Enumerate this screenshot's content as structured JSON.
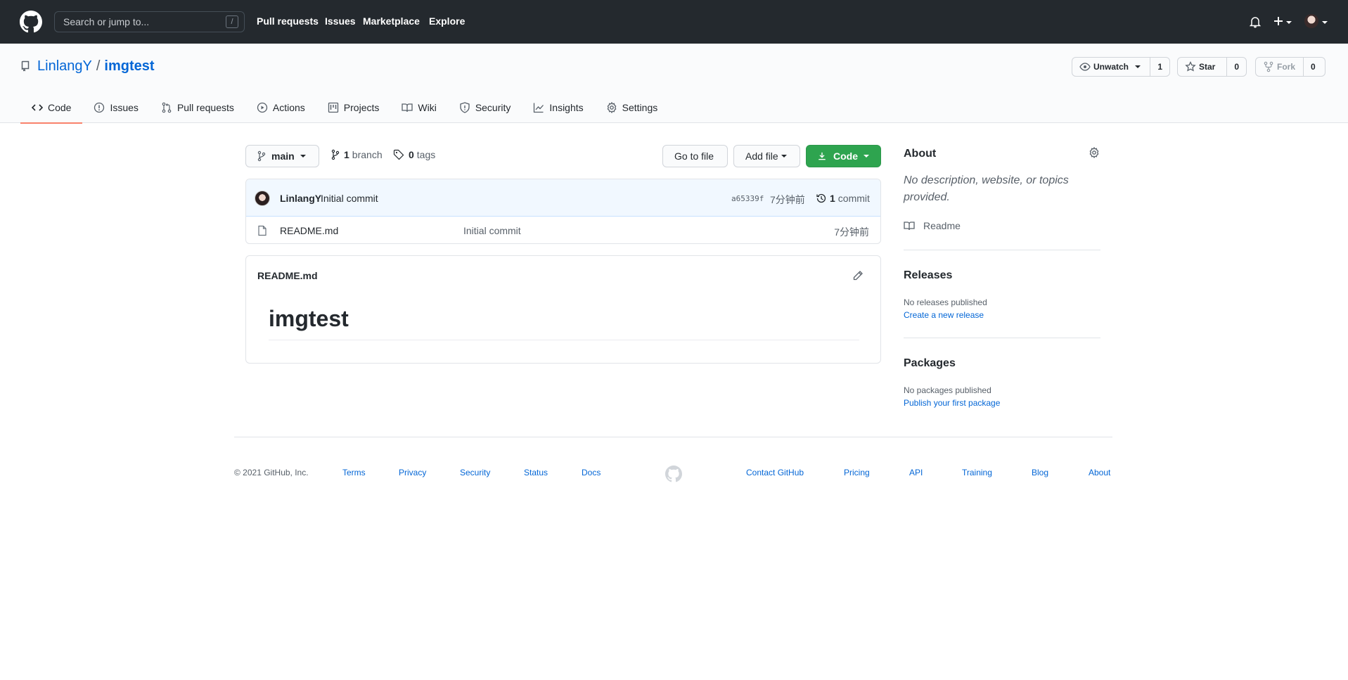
{
  "header": {
    "search_placeholder": "Search or jump to...",
    "search_shortcut": "/",
    "nav": [
      "Pull requests",
      "Issues",
      "Marketplace",
      "Explore"
    ]
  },
  "repo": {
    "owner": "LinlangY",
    "separator": "/",
    "name": "imgtest",
    "watch": {
      "label": "Unwatch",
      "count": "1"
    },
    "star": {
      "label": "Star",
      "count": "0"
    },
    "fork": {
      "label": "Fork",
      "count": "0"
    },
    "tabs": [
      "Code",
      "Issues",
      "Pull requests",
      "Actions",
      "Projects",
      "Wiki",
      "Security",
      "Insights",
      "Settings"
    ],
    "active_tab": "Code"
  },
  "toolbar": {
    "branch": "main",
    "branches_count": "1",
    "branches_label": "branch",
    "tags_count": "0",
    "tags_label": "tags",
    "go_to_file": "Go to file",
    "add_file": "Add file",
    "code": "Code"
  },
  "latest_commit": {
    "author": "LinlangY",
    "message": "Initial commit",
    "sha": "a65339f",
    "time": "7分钟前",
    "count": "1",
    "count_label": "commit"
  },
  "files": [
    {
      "name": "README.md",
      "message": "Initial commit",
      "time": "7分钟前"
    }
  ],
  "readme": {
    "filename": "README.md",
    "heading": "imgtest"
  },
  "sidebar": {
    "about_title": "About",
    "description": "No description, website, or topics provided.",
    "readme_label": "Readme",
    "releases_title": "Releases",
    "releases_none": "No releases published",
    "releases_link": "Create a new release",
    "packages_title": "Packages",
    "packages_none": "No packages published",
    "packages_link": "Publish your first package"
  },
  "footer": {
    "copyright": "© 2021 GitHub, Inc.",
    "left_links": [
      "Terms",
      "Privacy",
      "Security",
      "Status",
      "Docs"
    ],
    "right_links": [
      "Contact GitHub",
      "Pricing",
      "API",
      "Training",
      "Blog",
      "About"
    ]
  },
  "colors": {
    "header_bg": "#24292e",
    "link": "#0366d6",
    "green_button": "#2ea44f",
    "active_tab_underline": "#f9826c"
  }
}
